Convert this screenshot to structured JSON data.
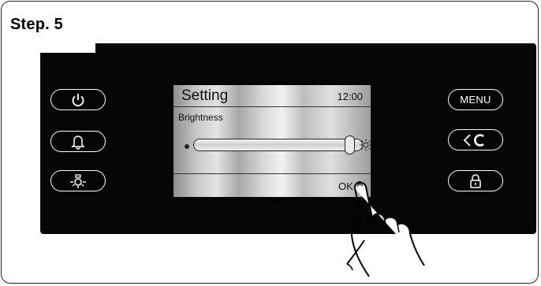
{
  "step": {
    "title": "Step. 5"
  },
  "left_buttons": [
    {
      "name": "power-button",
      "icon": "power-icon"
    },
    {
      "name": "alarm-button",
      "icon": "bell-icon"
    },
    {
      "name": "light-button",
      "icon": "lamp-icon"
    }
  ],
  "right_buttons": [
    {
      "name": "menu-button",
      "label": "MENU"
    },
    {
      "name": "back-clear-button",
      "icon": "back-c-icon"
    },
    {
      "name": "lock-button",
      "icon": "lock-icon"
    }
  ],
  "screen": {
    "title": "Setting",
    "time": "12:00",
    "setting_label": "Brightness",
    "ok_label": "OK",
    "brightness_level": 0.95
  },
  "colors": {
    "panel": "#050505",
    "button_outline": "#ffffff"
  }
}
